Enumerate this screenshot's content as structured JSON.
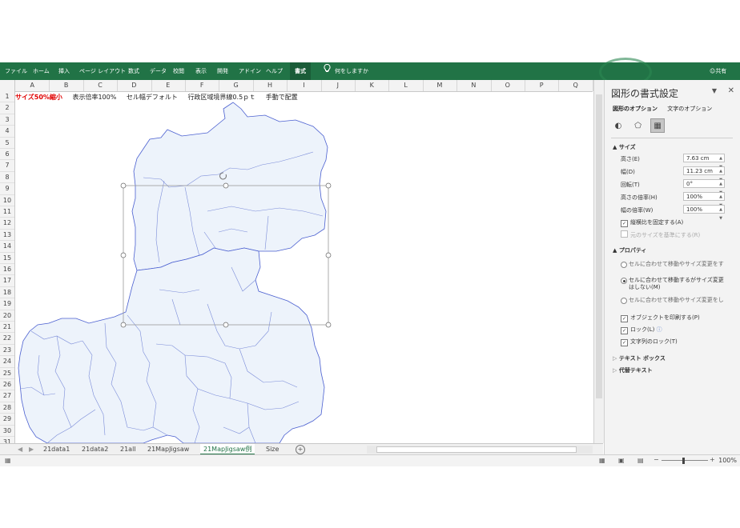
{
  "ribbon": {
    "tabs": [
      "ファイル",
      "ホーム",
      "挿入",
      "ページ レイアウト",
      "数式",
      "データ",
      "校閲",
      "表示",
      "開発",
      "アドイン",
      "ヘルプ",
      "書式"
    ],
    "active_tab": "書式",
    "tell_me": "何をしますか",
    "share": "共有",
    "bg_color": "#217346"
  },
  "sheet": {
    "columns": [
      "A",
      "B",
      "C",
      "D",
      "E",
      "F",
      "G",
      "H",
      "I",
      "J",
      "K",
      "L",
      "M",
      "N",
      "O",
      "P",
      "Q"
    ],
    "rows": [
      "1",
      "2",
      "3",
      "4",
      "5",
      "6",
      "7",
      "8",
      "9",
      "10",
      "11",
      "12",
      "13",
      "14",
      "15",
      "16",
      "17",
      "18",
      "19",
      "20",
      "21",
      "22",
      "23",
      "24",
      "25",
      "26",
      "27",
      "28",
      "29",
      "30",
      "31"
    ],
    "row1": {
      "red_text": "サイズ50%縮小",
      "notes": [
        "表示倍率100%",
        "セル幅デフォルト",
        "行政区域境界線0.5ｐｔ",
        "手動で配置"
      ]
    }
  },
  "sheet_tabs": [
    "21data1",
    "21data2",
    "21all",
    "21MapJigsaw",
    "21MapJigsaw例",
    "Size"
  ],
  "active_sheet": "21MapJigsaw例",
  "status": {
    "zoom": "100%"
  },
  "pane": {
    "title": "図形の書式設定",
    "tab_shape": "図形のオプション",
    "tab_text": "文字のオプション",
    "size_section": "サイズ",
    "fields": [
      {
        "label": "高さ(E)",
        "value": "7.63 cm"
      },
      {
        "label": "幅(D)",
        "value": "11.23 cm"
      },
      {
        "label": "回転(T)",
        "value": "0°"
      },
      {
        "label": "高さの倍率(H)",
        "value": "100%"
      },
      {
        "label": "幅の倍率(W)",
        "value": "100%"
      }
    ],
    "lock_aspect": "縦横比を固定する(A)",
    "relative_original": "元のサイズを基準にする(R)",
    "properties_section": "プロパティ",
    "radio1": "セルに合わせて移動やサイズ変更をする(S)",
    "radio2": "セルに合わせて移動するがサイズ変更はしない(M)",
    "radio3": "セルに合わせて移動やサイズ変更をしない(D)",
    "print_object": "オブジェクトを印刷する(P)",
    "lock": "ロック(L)",
    "lock_text": "文字列のロック(T)",
    "textbox_section": "テキスト ボックス",
    "alt_text_section": "代替テキスト"
  }
}
